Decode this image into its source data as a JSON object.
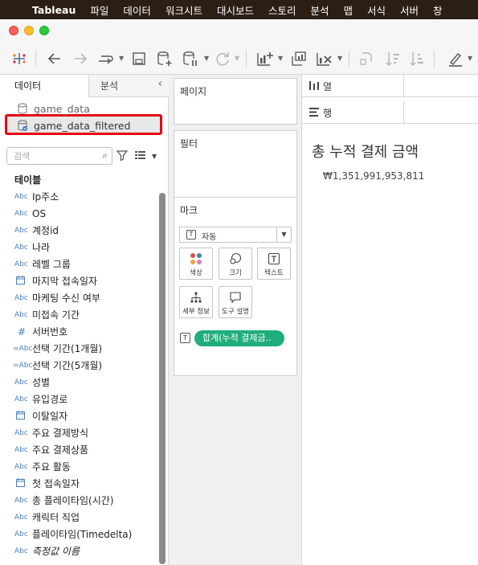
{
  "menubar": {
    "app": "Tableau",
    "items": [
      "파일",
      "데이터",
      "워크시트",
      "대시보드",
      "스토리",
      "분석",
      "맵",
      "서식",
      "서버",
      "창"
    ]
  },
  "left_pane": {
    "tabs": {
      "data": "데이터",
      "analysis": "분석"
    },
    "datasources": [
      {
        "name": "game_data",
        "selected": false
      },
      {
        "name": "game_data_filtered",
        "selected": true
      }
    ],
    "search_placeholder": "검색",
    "section_title": "테이블",
    "fields": [
      {
        "type": "Abc",
        "name": "Ip주소"
      },
      {
        "type": "Abc",
        "name": "OS"
      },
      {
        "type": "Abc",
        "name": "계정id"
      },
      {
        "type": "Abc",
        "name": "나라"
      },
      {
        "type": "Abc",
        "name": "레벨 그룹"
      },
      {
        "type": "date",
        "name": "마지막 접속일자"
      },
      {
        "type": "Abc",
        "name": "마케팅 수신 여부"
      },
      {
        "type": "Abc",
        "name": "미접속 기간"
      },
      {
        "type": "#",
        "name": "서버번호"
      },
      {
        "type": "=Abc",
        "name": "선택 기간(1개월)"
      },
      {
        "type": "=Abc",
        "name": "선택 기간(5개월)"
      },
      {
        "type": "Abc",
        "name": "성별"
      },
      {
        "type": "Abc",
        "name": "유입경로"
      },
      {
        "type": "date",
        "name": "이탈일자"
      },
      {
        "type": "Abc",
        "name": "주요 결제방식"
      },
      {
        "type": "Abc",
        "name": "주요 결제상품"
      },
      {
        "type": "Abc",
        "name": "주요 활동"
      },
      {
        "type": "date",
        "name": "첫 접속일자"
      },
      {
        "type": "Abc",
        "name": "총 플레이타임(시간)"
      },
      {
        "type": "Abc",
        "name": "캐릭터 직업"
      },
      {
        "type": "Abc",
        "name": "플레이타임(Timedelta)"
      },
      {
        "type": "Abc",
        "name": "측정값 이름",
        "italic": true
      }
    ]
  },
  "shelves": {
    "pages": "페이지",
    "filters": "필터",
    "marks": {
      "title": "마크",
      "type": "자동",
      "buttons": [
        "색상",
        "크기",
        "텍스트",
        "세부 정보",
        "도구 설명"
      ],
      "pill": "합계(누적 결제금.."
    }
  },
  "canvas": {
    "columns_label": "열",
    "rows_label": "행",
    "title": "총 누적 결제 금액",
    "value": "₩1,351,991,953,811"
  },
  "colors": {
    "menubar_bg": "#2b1e14",
    "pill_green": "#1fae7a",
    "highlight_red": "#e60012",
    "field_icon_blue": "#4a7fb5"
  }
}
